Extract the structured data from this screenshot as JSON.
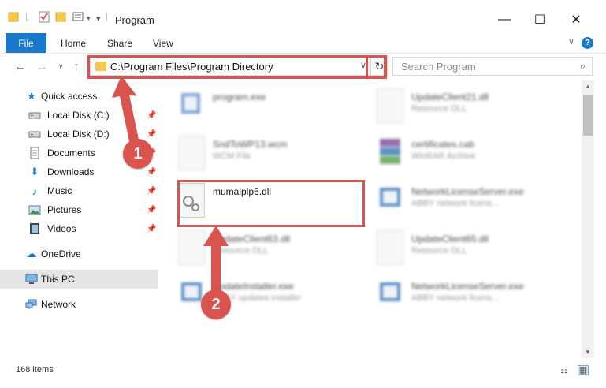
{
  "window": {
    "title": "Program",
    "minimize": "—",
    "maximize": "☐",
    "close": "✕"
  },
  "ribbon": {
    "file": "File",
    "home": "Home",
    "share": "Share",
    "view": "View",
    "help": "?"
  },
  "nav": {
    "back": "←",
    "forward": "→",
    "recent": "∨",
    "up": "↑"
  },
  "address": {
    "path": "C:\\Program Files\\Program Directory",
    "refresh": "↻"
  },
  "search": {
    "placeholder": "Search Program"
  },
  "sidebar": {
    "items": [
      {
        "label": "Quick access",
        "icon": "star-icon"
      },
      {
        "label": "Local Disk (C:)",
        "icon": "drive-icon"
      },
      {
        "label": "Local Disk (D:)",
        "icon": "drive-icon"
      },
      {
        "label": "Documents",
        "icon": "documents-icon"
      },
      {
        "label": "Downloads",
        "icon": "download-icon"
      },
      {
        "label": "Music",
        "icon": "music-icon"
      },
      {
        "label": "Pictures",
        "icon": "pictures-icon"
      },
      {
        "label": "Videos",
        "icon": "videos-icon"
      },
      {
        "label": "OneDrive",
        "icon": "cloud-icon"
      },
      {
        "label": "This PC",
        "icon": "computer-icon"
      },
      {
        "label": "Network",
        "icon": "network-icon"
      }
    ]
  },
  "files": [
    {
      "name": "program.exe",
      "sub": ""
    },
    {
      "name": "UpdateClient21.dll",
      "sub": "Resource DLL"
    },
    {
      "name": "SndToWP13.wcm",
      "sub": "WCM File"
    },
    {
      "name": "certificates.cab",
      "sub": "WinRAR Archive"
    },
    {
      "name": "mumaiplp6.dll",
      "sub": ""
    },
    {
      "name": "NetworkLicenseServer.exe",
      "sub": "ABBY network licens..."
    },
    {
      "name": "UpdateClient63.dll",
      "sub": "Resource DLL"
    },
    {
      "name": "UpdateClient65.dll",
      "sub": "Resource DLL"
    },
    {
      "name": "UpdateInstaller.exe",
      "sub": "ABBY updates installer"
    },
    {
      "name": "NetworkLicenseServer.exe",
      "sub": "ABBY network licens..."
    }
  ],
  "status": {
    "count": "168 items"
  },
  "callouts": {
    "one": "1",
    "two": "2"
  },
  "colors": {
    "accent": "#1979ca",
    "callout": "#d9534f",
    "folder": "#f3c84b"
  }
}
